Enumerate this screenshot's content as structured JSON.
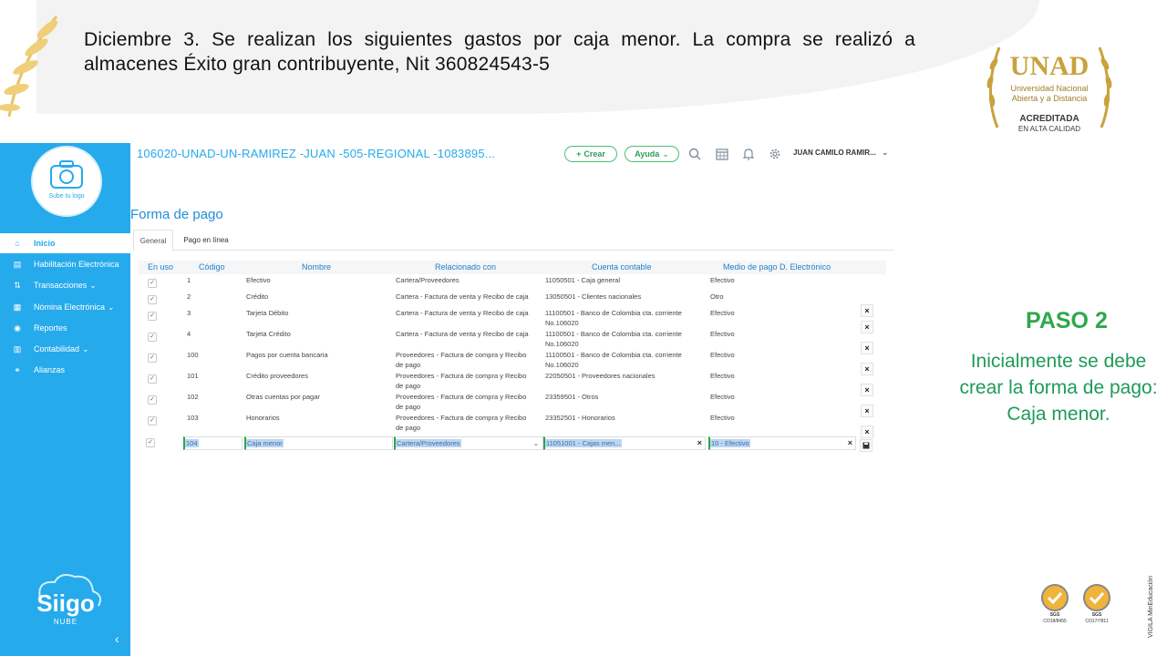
{
  "slide": {
    "text": "Diciembre 3. Se realizan los siguientes gastos por caja menor. La compra se realizó a almacenes Éxito gran contribuyente, Nit 360824543-5",
    "paso_title": "PASO 2",
    "paso_text": "Inicialmente se debe crear la forma de pago: Caja menor.",
    "unad_logo": {
      "acronym": "UNAD",
      "line1": "Universidad Nacional",
      "line2": "Abierta y a Distancia",
      "banner1": "ACREDITADA",
      "banner2": "EN ALTA CALIDAD"
    },
    "certs": [
      {
        "label": "SGS",
        "code": "CO18/8455"
      },
      {
        "label": "SGS",
        "code": "CO17/7811"
      }
    ],
    "vertical_tag": "VIGILA MinEducación",
    "accent_green": "#2ea84a"
  },
  "app": {
    "breadcrumb": "106020-UNAD-UN-RAMIREZ -JUAN -505-REGIONAL -1083895...",
    "create_button": "Crear",
    "help_button": "Ayuda",
    "user_name": "JUAN CAMILO RAMIR...",
    "sidebar": {
      "logo_label": "Sube tu logo",
      "brand": "Siigo",
      "brand_sub": "NUBE",
      "items": [
        {
          "label": "Inicio",
          "icon": "home-icon",
          "glyph": "⌂",
          "chevron": ""
        },
        {
          "label": "Habilitación Electrónica",
          "icon": "document-icon",
          "glyph": "▤",
          "chevron": ""
        },
        {
          "label": "Transacciones",
          "icon": "transactions-icon",
          "glyph": "⇅",
          "chevron": "⌄"
        },
        {
          "label": "Nómina Electrónica",
          "icon": "payroll-icon",
          "glyph": "▦",
          "chevron": "⌄"
        },
        {
          "label": "Reportes",
          "icon": "reports-icon",
          "glyph": "◉",
          "chevron": ""
        },
        {
          "label": "Contabilidad",
          "icon": "accounting-icon",
          "glyph": "▥",
          "chevron": "⌄"
        },
        {
          "label": "Alianzas",
          "icon": "link-icon",
          "glyph": "⚭",
          "chevron": ""
        }
      ],
      "accent": "#25aaec"
    },
    "page_title": "Forma de pago",
    "tabs": [
      "General",
      "Pago en línea"
    ],
    "columns": [
      "En uso",
      "Código",
      "Nombre",
      "Relacionado con",
      "Cuenta contable",
      "Medio de pago D. Electrónico"
    ],
    "rows": [
      {
        "code": "1",
        "name": "Efectivo",
        "related": [
          "Cartera/Proveedores"
        ],
        "account": [
          "11050501 - Caja general"
        ],
        "medium": "Efectivo",
        "delete": false
      },
      {
        "code": "2",
        "name": "Crédito",
        "related": [
          "Cartera - Factura de venta y Recibo de caja"
        ],
        "account": [
          "13050501 - Clientes nacionales"
        ],
        "medium": "Otro",
        "delete": true
      },
      {
        "code": "3",
        "name": "Tarjeta Débito",
        "related": [
          "Cartera - Factura de venta y Recibo de caja"
        ],
        "account": [
          "11100501 - Banco de Colombia cta. corriente",
          "No.106020"
        ],
        "medium": "Efectivo",
        "delete": true
      },
      {
        "code": "4",
        "name": "Tarjeta Crédito",
        "related": [
          "Cartera - Factura de venta y Recibo de caja"
        ],
        "account": [
          "11100501 - Banco de Colombia cta. corriente",
          "No.106020"
        ],
        "medium": "Efectivo",
        "delete": true
      },
      {
        "code": "100",
        "name": "Pagos por cuenta bancaria",
        "related": [
          "Proveedores - Factura de compra y Recibo",
          "de pago"
        ],
        "account": [
          "11100501 - Banco de Colombia cta. corriente",
          "No.106020"
        ],
        "medium": "Efectivo",
        "delete": true
      },
      {
        "code": "101",
        "name": "Crédito proveedores",
        "related": [
          "Proveedores - Factura de compra y Recibo",
          "de pago"
        ],
        "account": [
          "22050501 - Proveedores nacionales"
        ],
        "medium": "Efectivo",
        "delete": true
      },
      {
        "code": "102",
        "name": "Otras cuentas por pagar",
        "related": [
          "Proveedores - Factura de compra y Recibo",
          "de pago"
        ],
        "account": [
          "23359501 - Otros"
        ],
        "medium": "Efectivo",
        "delete": true
      },
      {
        "code": "103",
        "name": "Honorarios",
        "related": [
          "Proveedores - Factura de compra y Recibo",
          "de pago"
        ],
        "account": [
          "23352501 - Honorarios"
        ],
        "medium": "Efectivo",
        "delete": true
      }
    ],
    "edit_row": {
      "code": "104",
      "name": "Caja menor",
      "related": "Cartera/Proveedores",
      "account": "11051001 - Cajas men...",
      "medium": "10 - Efectivo"
    }
  }
}
